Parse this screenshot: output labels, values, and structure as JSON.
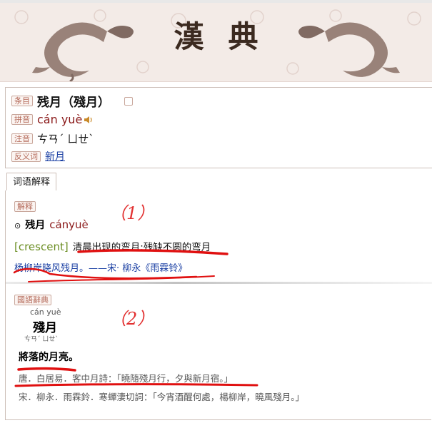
{
  "header": {
    "title": "漢典"
  },
  "entry": {
    "label_entry": "条目",
    "headword": "残月（殘月）",
    "label_pinyin": "拼音",
    "pinyin": "cán yuè",
    "label_zhuyin": "注音",
    "zhuyin": "ㄘㄢˊ ㄩㄝˋ",
    "label_antonym": "反义词",
    "antonym": "新月"
  },
  "tabs": [
    {
      "label": "词语解释"
    }
  ],
  "section1": {
    "tag": "解释",
    "bullet": "⊙",
    "word": "残月",
    "word_pinyin": "cányuè",
    "english": "[crescent]",
    "definition": "清晨出现的弯月;残缺不圆的弯月",
    "example": "杨柳岸晓风残月。——宋· 柳永《雨霖铃》",
    "annotation": "（1）"
  },
  "section2": {
    "tag": "國語辭典",
    "pinyin": "cán yuè",
    "word": "殘月",
    "zhuyin": "ㄘㄢˊ ㄩㄝˋ",
    "definition": "將落的月亮。",
    "quote1": "唐．白居易．客中月詩：「曉隨殘月行，夕與新月宿。」",
    "quote2": "宋．柳永．雨霖鈴．寒蟬淒切詞：「今宵酒醒何處，楊柳岸，曉風殘月。」",
    "annotation": "（2）"
  },
  "colors": {
    "accent_red": "#8b1a1a",
    "link_blue": "#1a3fa3",
    "marker_red": "#e01010",
    "header_bg": "#f3ebe7"
  },
  "icons": [
    "dragon-left-icon",
    "dragon-right-icon",
    "speaker-icon",
    "small-square-icon"
  ]
}
